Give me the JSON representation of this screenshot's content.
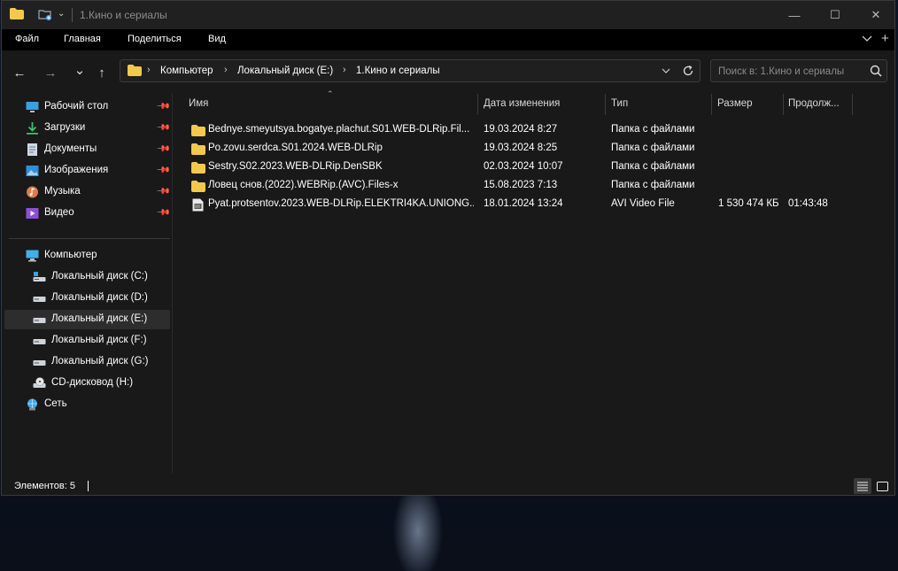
{
  "window": {
    "title": "1.Кино и сериалы",
    "controls": {
      "minimize": "—",
      "maximize": "☐",
      "close": "✕"
    }
  },
  "menu": {
    "items": [
      "Файл",
      "Главная",
      "Поделиться",
      "Вид"
    ],
    "collapse_icon": "chevron-down-icon",
    "add_icon": "+"
  },
  "nav": {
    "back": "←",
    "forward": "→",
    "recent": "⌄",
    "up": "↑"
  },
  "address": {
    "crumbs": [
      "Компьютер",
      "Локальный диск (E:)",
      "1.Кино и сериалы"
    ],
    "separator": "›"
  },
  "search": {
    "placeholder": "Поиск в: 1.Кино и сериалы"
  },
  "sidebar": {
    "quick_access": [
      {
        "label": "Рабочий стол",
        "icon": "desktop-icon",
        "pinned": true
      },
      {
        "label": "Загрузки",
        "icon": "downloads-icon",
        "pinned": true
      },
      {
        "label": "Документы",
        "icon": "documents-icon",
        "pinned": true
      },
      {
        "label": "Изображения",
        "icon": "pictures-icon",
        "pinned": true
      },
      {
        "label": "Музыка",
        "icon": "music-icon",
        "pinned": true
      },
      {
        "label": "Видео",
        "icon": "videos-icon",
        "pinned": true
      }
    ],
    "computer": {
      "label": "Компьютер",
      "icon": "computer-icon"
    },
    "drives": [
      {
        "label": "Локальный диск (C:)",
        "icon": "system-drive-icon"
      },
      {
        "label": "Локальный диск (D:)",
        "icon": "drive-icon"
      },
      {
        "label": "Локальный диск (E:)",
        "icon": "drive-icon",
        "selected": true
      },
      {
        "label": "Локальный диск (F:)",
        "icon": "drive-icon"
      },
      {
        "label": "Локальный диск (G:)",
        "icon": "drive-icon"
      },
      {
        "label": "CD-дисковод (H:)",
        "icon": "cd-drive-icon"
      }
    ],
    "network": {
      "label": "Сеть",
      "icon": "network-icon"
    }
  },
  "columns": [
    "Имя",
    "Дата изменения",
    "Тип",
    "Размер",
    "Продолж..."
  ],
  "files": [
    {
      "name": "Bednye.smeyutsya.bogatye.plachut.S01.WEB-DLRip.Fil...",
      "date": "19.03.2024 8:27",
      "type": "Папка с файлами",
      "size": "",
      "duration": "",
      "icon": "folder-icon"
    },
    {
      "name": "Po.zovu.serdca.S01.2024.WEB-DLRip",
      "date": "19.03.2024 8:25",
      "type": "Папка с файлами",
      "size": "",
      "duration": "",
      "icon": "folder-icon"
    },
    {
      "name": "Sestry.S02.2023.WEB-DLRip.DenSBK",
      "date": "02.03.2024 10:07",
      "type": "Папка с файлами",
      "size": "",
      "duration": "",
      "icon": "folder-icon"
    },
    {
      "name": "Ловец снов.(2022).WEBRip.(AVC).Files-x",
      "date": "15.08.2023 7:13",
      "type": "Папка с файлами",
      "size": "",
      "duration": "",
      "icon": "folder-icon"
    },
    {
      "name": "Pyat.protsentov.2023.WEB-DLRip.ELEKTRI4KA.UNIONG...",
      "date": "18.01.2024 13:24",
      "type": "AVI Video File",
      "size": "1 530 474 КБ",
      "duration": "01:43:48",
      "icon": "video-file-icon"
    }
  ],
  "status": {
    "count_text": "Элементов: 5"
  },
  "colors": {
    "folder": "#f2c94c",
    "background": "#191919",
    "selected": "#2d2d2d"
  }
}
